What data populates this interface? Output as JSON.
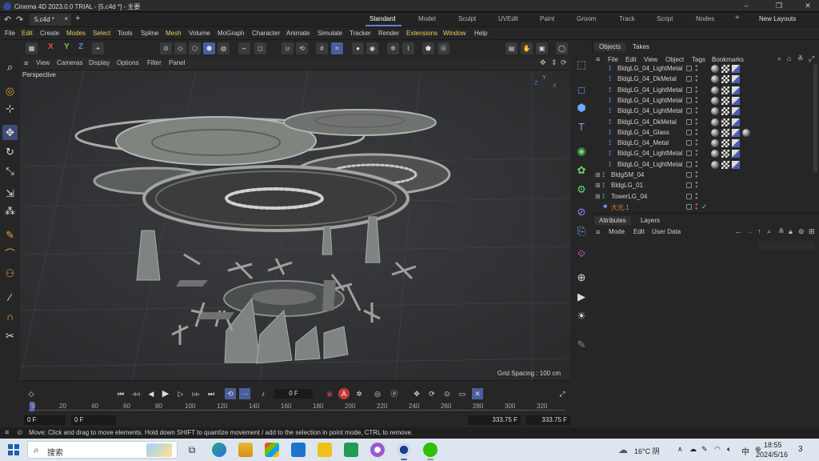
{
  "titlebar": {
    "title": "Cinema 4D 2023.0.0 TRIAL - [5.c4d *] - 主要",
    "minimize": "–",
    "maximize": "❐",
    "close": "✕"
  },
  "tabs": {
    "doc_tab": "5.c4d *",
    "doc_close": "×",
    "add": "+",
    "layouts": [
      "Standard",
      "Model",
      "Sculpt",
      "UVEdit",
      "Paint",
      "Groom",
      "Track",
      "Script",
      "Nodes"
    ],
    "active_layout": "Standard",
    "new_layouts": "New Layouts",
    "add_layout": "+"
  },
  "menu": [
    "File",
    "Edit",
    "Create",
    "Modes",
    "Select",
    "Tools",
    "Spline",
    "Mesh",
    "Volume",
    "MoGraph",
    "Character",
    "Animate",
    "Simulate",
    "Tracker",
    "Render",
    "Extensions",
    "Window",
    "Help"
  ],
  "toolbar": {
    "x": "X",
    "y": "Y",
    "z": "Z"
  },
  "viewport": {
    "menu": [
      "View",
      "Cameras",
      "Display",
      "Options",
      "Filter",
      "Panel"
    ],
    "label": "Perspective",
    "grid_spacing": "Grid Spacing : 100 cm",
    "axis_y": "Y",
    "axis_x": "X",
    "axis_z": "Z"
  },
  "timeline": {
    "current_frame": "0 F",
    "start_a": "0 F",
    "start_b": "0 F",
    "end_a": "333.75 F",
    "end_b": "333.75 F",
    "ruler": [
      "0",
      "20",
      "40",
      "60",
      "80",
      "100",
      "120",
      "140",
      "160",
      "180",
      "200",
      "220",
      "240",
      "260",
      "280",
      "300",
      "320"
    ]
  },
  "objects_panel": {
    "tabs": [
      "Objects",
      "Takes"
    ],
    "menu": [
      "File",
      "Edit",
      "View",
      "Object",
      "Tags",
      "Bookmarks"
    ],
    "rows": [
      {
        "name": "BldgLG_04_LightMetal",
        "indent": 2
      },
      {
        "name": "BldgLG_04_DkMetal",
        "indent": 2
      },
      {
        "name": "BldgLG_04_LightMetal",
        "indent": 2
      },
      {
        "name": "BldgLG_04_LightMetal",
        "indent": 2
      },
      {
        "name": "BldgLG_04_LightMetal",
        "indent": 2
      },
      {
        "name": "BldgLG_04_DkMetal",
        "indent": 2
      },
      {
        "name": "BldgLG_04_Glass",
        "indent": 2
      },
      {
        "name": "BldgLG_04_Metal",
        "indent": 2
      },
      {
        "name": "BldgLG_04_LightMetal",
        "indent": 2
      },
      {
        "name": "BldgLG_04_LightMetal",
        "indent": 2
      },
      {
        "name": "BldgSM_04",
        "indent": 1
      },
      {
        "name": "BldgLG_01",
        "indent": 1
      },
      {
        "name": "TowerLG_04",
        "indent": 1
      },
      {
        "name": "大光.1",
        "indent": 1
      }
    ]
  },
  "attributes_panel": {
    "tabs": [
      "Attributes",
      "Layers"
    ],
    "menu": [
      "Mode",
      "Edit",
      "User Data"
    ]
  },
  "status": {
    "message": "Move: Click and drag to move elements. Hold down SHIFT to quantize movement / add to the selection in point mode, CTRL to remove."
  },
  "taskbar": {
    "search": "搜索",
    "weather": "16°C 阴",
    "ime": "中",
    "time": "18:55",
    "date": "2024/5/16",
    "notifications": "3"
  },
  "colors": {
    "accent": "#6a7fd4",
    "menu_highlight": "#e6cf61",
    "viewport_bg": "#333436"
  }
}
